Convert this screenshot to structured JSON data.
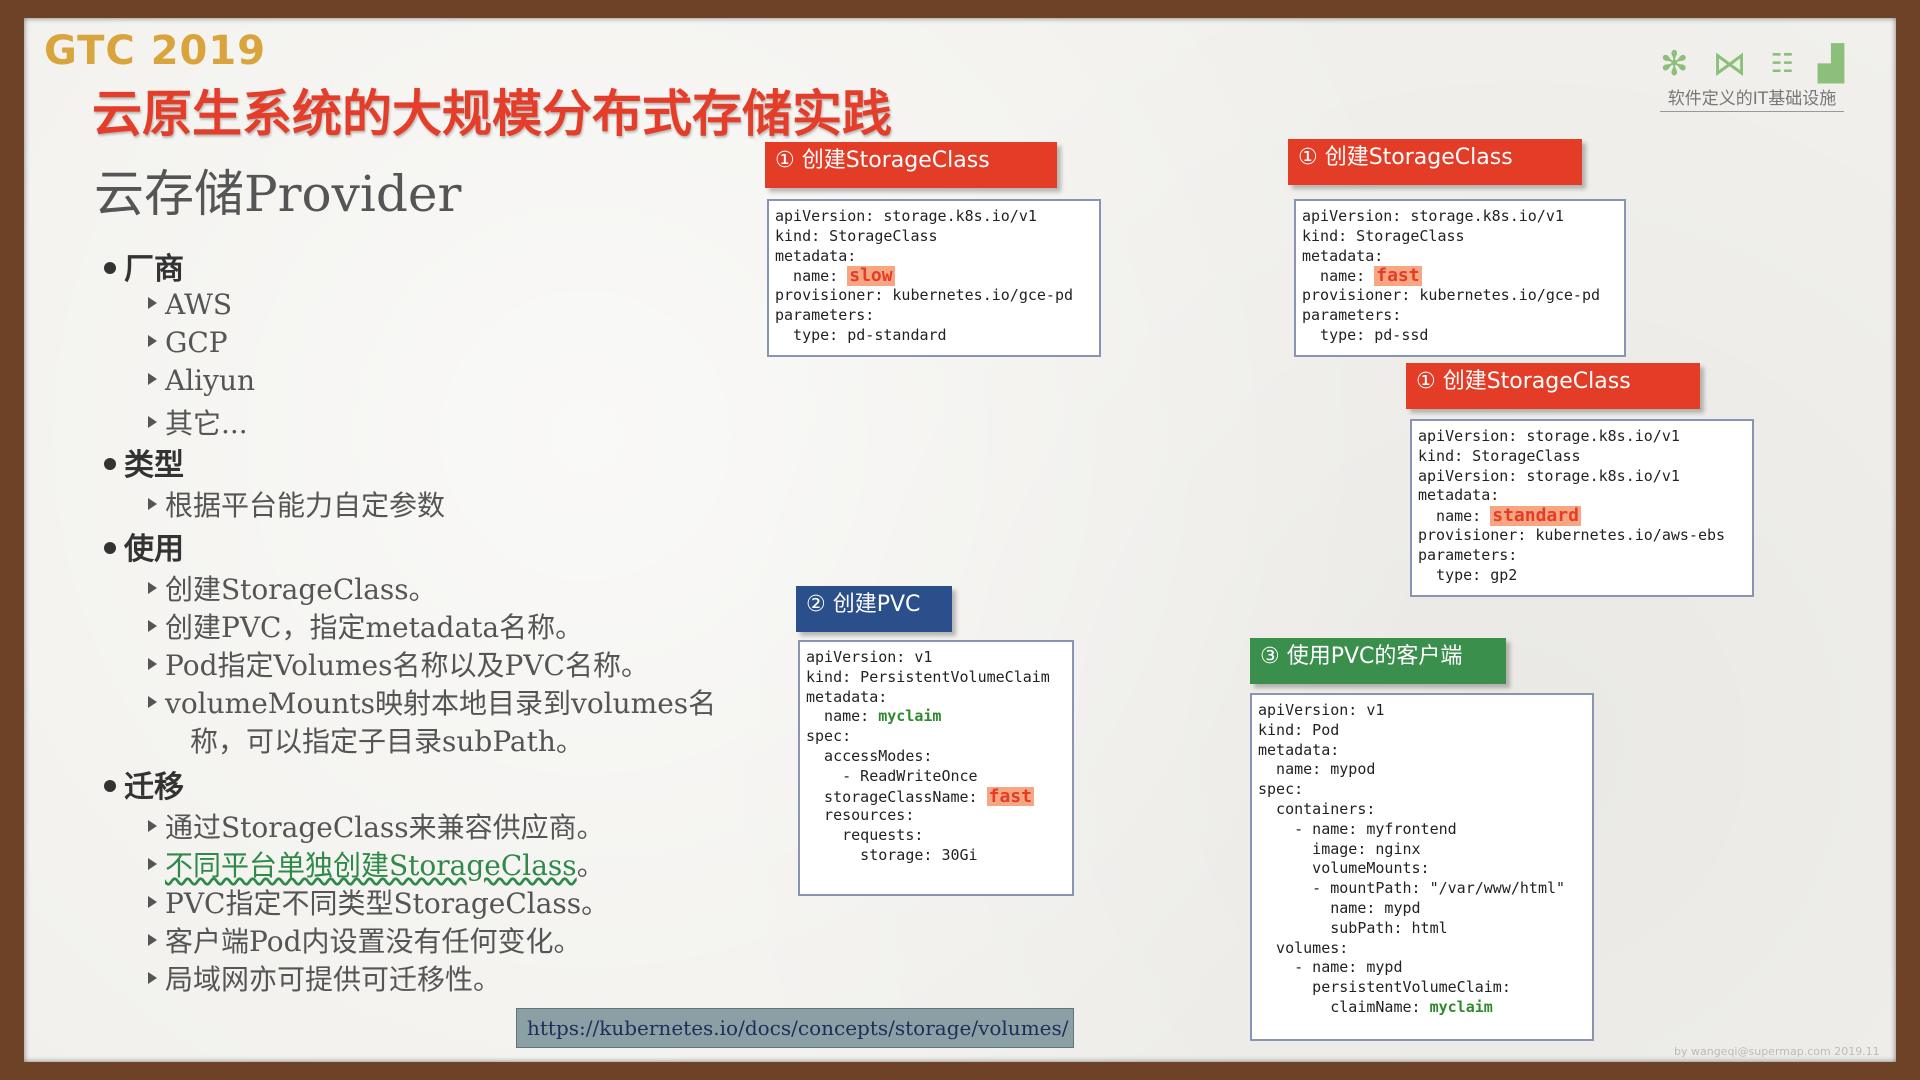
{
  "header": {
    "logo": "GTC 2019",
    "title": "云原生系统的大规模分布式存储实践",
    "subtitle": "云存储Provider",
    "brand_caption": "软件定义的IT基础设施",
    "brand_icons": [
      "snowflake-icon",
      "network-icon",
      "org-chart-icon",
      "city-icon"
    ]
  },
  "bullets": {
    "vendor": {
      "label": "厂商",
      "items": [
        "AWS",
        "GCP",
        "Aliyun",
        "其它..."
      ]
    },
    "type": {
      "label": "类型",
      "items": [
        "根据平台能力自定参数"
      ]
    },
    "usage": {
      "label": "使用",
      "items": [
        "创建StorageClass。",
        "创建PVC，指定metadata名称。",
        "Pod指定Volumes名称以及PVC名称。",
        "volumeMounts映射本地目录到volumes名"
      ],
      "continuation": "称，可以指定子目录subPath。"
    },
    "migration": {
      "label": "迁移",
      "items": [
        "通过StorageClass来兼容供应商。",
        "不同平台单独创建StorageClass",
        "PVC指定不同类型StorageClass。",
        "客户端Pod内设置没有任何变化。",
        "局域网亦可提供可迁移性。"
      ],
      "link_suffix": "。"
    }
  },
  "panels": {
    "sc_slow": {
      "tab": "① 创建StorageClass",
      "l1": "apiVersion: storage.k8s.io/v1",
      "l2": "kind: StorageClass",
      "l3": "metadata:",
      "l4_prefix": "  name: ",
      "l4_value": "slow",
      "l5": "provisioner: kubernetes.io/gce-pd",
      "l6": "parameters:",
      "l7": "  type: pd-standard"
    },
    "sc_fast": {
      "tab": "① 创建StorageClass",
      "l1": "apiVersion: storage.k8s.io/v1",
      "l2": "kind: StorageClass",
      "l3": "metadata:",
      "l4_prefix": "  name: ",
      "l4_value": "fast",
      "l5": "provisioner: kubernetes.io/gce-pd",
      "l6": "parameters:",
      "l7": "  type: pd-ssd"
    },
    "sc_standard": {
      "tab": "① 创建StorageClass",
      "l1": "apiVersion: storage.k8s.io/v1",
      "l2": "kind: StorageClass",
      "l3": "apiVersion: storage.k8s.io/v1",
      "l4": "metadata:",
      "l5_prefix": "  name: ",
      "l5_value": "standard",
      "l6": "provisioner: kubernetes.io/aws-ebs",
      "l7": "parameters:",
      "l8": "  type: gp2"
    },
    "pvc": {
      "tab": "② 创建PVC",
      "l1": "apiVersion: v1",
      "l2": "kind: PersistentVolumeClaim",
      "l3": "metadata:",
      "l4_prefix": "  name: ",
      "l4_value": "myclaim",
      "l5": "spec:",
      "l6": "  accessModes:",
      "l7": "    - ReadWriteOnce",
      "l8_prefix": "  storageClassName: ",
      "l8_value": "fast",
      "l9": "  resources:",
      "l10": "    requests:",
      "l11": "      storage: 30Gi"
    },
    "pod": {
      "tab": "③ 使用PVC的客户端",
      "l1": "apiVersion: v1",
      "l2": "kind: Pod",
      "l3": "metadata:",
      "l4": "  name: mypod",
      "l5": "spec:",
      "l6": "  containers:",
      "l7": "    - name: myfrontend",
      "l8": "      image: nginx",
      "l9": "      volumeMounts:",
      "l10": "      - mountPath: \"/var/www/html\"",
      "l11": "        name: mypd",
      "l12": "        subPath: html",
      "l13": "  volumes:",
      "l14": "    - name: mypd",
      "l15": "      persistentVolumeClaim:",
      "l16_prefix": "        claimName: ",
      "l16_value": "myclaim"
    }
  },
  "footer": {
    "url": "https://kubernetes.io/docs/concepts/storage/volumes/",
    "note": "by wangeqi@supermap.com 2019.11"
  },
  "colors": {
    "title_red": "#e43d2a",
    "tab_red": "#e33d28",
    "tab_blue": "#2b4f8a",
    "tab_green": "#3a8f4d",
    "logo_gold": "#d9a43c",
    "link_green": "#2f8a4a"
  }
}
